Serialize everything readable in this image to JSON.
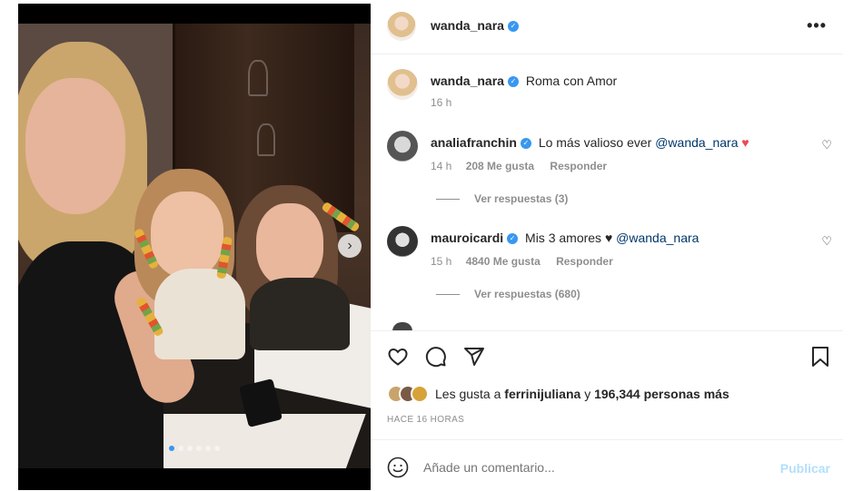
{
  "post": {
    "username": "wanda_nara",
    "verified_mark": "✓",
    "more_icon": "•••",
    "caption": "Roma con Amor",
    "caption_time": "16 h",
    "next_icon": "›",
    "carousel": {
      "count": 6,
      "active": 1
    }
  },
  "comments": [
    {
      "username": "analiafranchin",
      "text": "Lo más valioso ever",
      "mention": "@wanda_nara",
      "emoji": "♥",
      "time": "14 h",
      "likes": "208 Me gusta",
      "reply": "Responder",
      "view_replies": "Ver respuestas (3)"
    },
    {
      "username": "mauroicardi",
      "text": "Mis 3 amores ♥",
      "mention": "@wanda_nara",
      "time": "15 h",
      "likes": "4840 Me gusta",
      "reply": "Responder",
      "view_replies": "Ver respuestas (680)"
    }
  ],
  "likes": {
    "prefix": "Les gusta a",
    "user": "ferrinijuliana",
    "middle": "y",
    "count": "196,344 personas más"
  },
  "timestamp": "HACE 16 HORAS",
  "comment_box": {
    "placeholder": "Añade un comentario...",
    "post_label": "Publicar"
  },
  "icons": [
    "heart-icon",
    "comment-icon",
    "share-icon",
    "bookmark-icon",
    "emoji-icon",
    "like-comment-icon",
    "more-icon",
    "chevron-right-icon"
  ],
  "colors": {
    "link": "#00376b",
    "verified": "#3897f0",
    "muted": "#8e8e8e",
    "publish": "#b2dffc",
    "heart": "#ed4956"
  }
}
